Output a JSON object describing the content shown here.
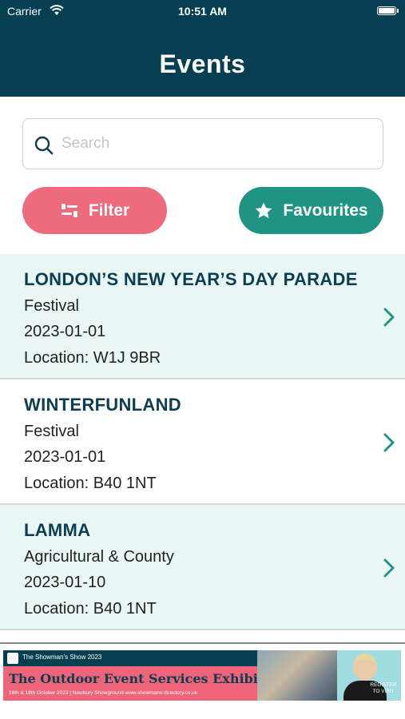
{
  "status_bar": {
    "carrier": "Carrier",
    "time": "10:51 AM"
  },
  "header": {
    "title": "Events"
  },
  "search": {
    "placeholder": "Search",
    "value": ""
  },
  "buttons": {
    "filter_label": "Filter",
    "favourites_label": "Favourites"
  },
  "colors": {
    "header": "#063f52",
    "filter": "#ee6b7d",
    "favourites": "#1f9484",
    "row_alt": "#e8f6f4",
    "accent": "#1f9484"
  },
  "events": [
    {
      "name": "LONDON’S NEW YEAR’S DAY PARADE",
      "category": "Festival",
      "date": "2023-01-01",
      "location": "Location: W1J 9BR"
    },
    {
      "name": "WINTERFUNLAND",
      "category": "Festival",
      "date": "2023-01-01",
      "location": "Location: B40 1NT"
    },
    {
      "name": "LAMMA",
      "category": "Agricultural & County",
      "date": "2023-01-10",
      "location": "Location: B40 1NT"
    }
  ],
  "ad": {
    "brand": "The Showman's Show 2023",
    "headline": "The Outdoor Event Services Exhibition",
    "details": "18th & 19th October 2023 | Newbury Showground   www.showmans-directory.co.uk",
    "cta": "REGISTER TO VISIT"
  }
}
